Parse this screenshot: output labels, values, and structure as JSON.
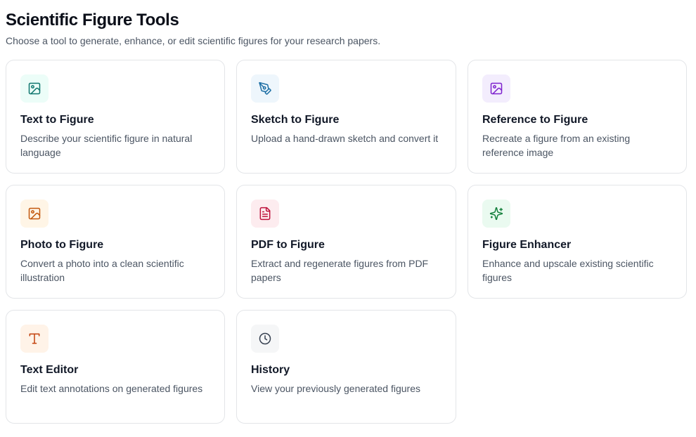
{
  "header": {
    "title": "Scientific Figure Tools",
    "subtitle": "Choose a tool to generate, enhance, or edit scientific figures for your research papers."
  },
  "tools": [
    {
      "title": "Text to Figure",
      "description": "Describe your scientific figure in natural language",
      "icon": "image-icon",
      "icon_color": "#0f766e",
      "tile_color": "#ecfdf8"
    },
    {
      "title": "Sketch to Figure",
      "description": "Upload a hand-drawn sketch and convert it",
      "icon": "pen-tool-icon",
      "icon_color": "#1d6fa5",
      "tile_color": "#eef6fc"
    },
    {
      "title": "Reference to Figure",
      "description": "Recreate a figure from an existing reference image",
      "icon": "image-icon",
      "icon_color": "#7e22ce",
      "tile_color": "#f3edfd"
    },
    {
      "title": "Photo to Figure",
      "description": "Convert a photo into a clean scientific illustration",
      "icon": "image-icon",
      "icon_color": "#c2570c",
      "tile_color": "#fff5e6"
    },
    {
      "title": "PDF to Figure",
      "description": "Extract and regenerate figures from PDF papers",
      "icon": "file-text-icon",
      "icon_color": "#be123c",
      "tile_color": "#fdecef"
    },
    {
      "title": "Figure Enhancer",
      "description": "Enhance and upscale existing scientific figures",
      "icon": "sparkles-icon",
      "icon_color": "#15803d",
      "tile_color": "#eafaf0"
    },
    {
      "title": "Text Editor",
      "description": "Edit text annotations on generated figures",
      "icon": "type-icon",
      "icon_color": "#c2410c",
      "tile_color": "#fff3e8"
    },
    {
      "title": "History",
      "description": "View your previously generated figures",
      "icon": "clock-icon",
      "icon_color": "#374151",
      "tile_color": "#f5f6f7"
    }
  ]
}
